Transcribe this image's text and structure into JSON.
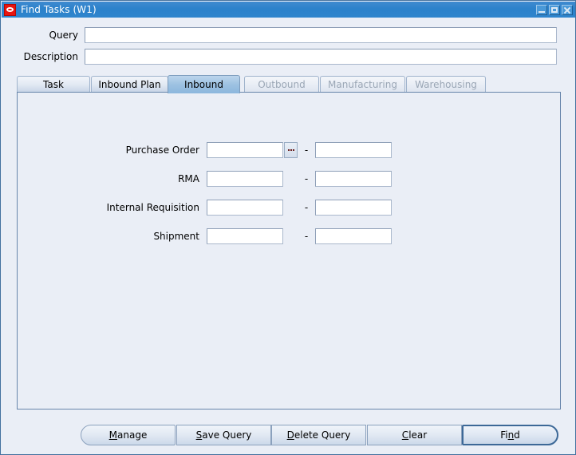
{
  "window": {
    "title": "Find Tasks (W1)",
    "icon": "oracle-logo-icon",
    "controls": {
      "minimize": "minimize-icon",
      "maximize": "maximize-icon",
      "close": "close-icon"
    }
  },
  "header": {
    "query": {
      "label": "Query",
      "value": "",
      "placeholder": ""
    },
    "description": {
      "label": "Description",
      "value": "",
      "placeholder": ""
    }
  },
  "tabs": [
    {
      "label": "Task",
      "state": "enabled",
      "selected": false
    },
    {
      "label": "Inbound Plan",
      "state": "enabled",
      "selected": false
    },
    {
      "label": "Inbound",
      "state": "enabled",
      "selected": true
    },
    {
      "label": "Outbound",
      "state": "disabled",
      "selected": false
    },
    {
      "label": "Manufacturing",
      "state": "disabled",
      "selected": false
    },
    {
      "label": "Warehousing",
      "state": "disabled",
      "selected": false
    }
  ],
  "form": {
    "separator": "-",
    "rows": [
      {
        "label": "Purchase Order",
        "from": "",
        "to": "",
        "lov": true,
        "lov_icon": "ellipsis-lov-icon"
      },
      {
        "label": "RMA",
        "from": "",
        "to": "",
        "lov": false,
        "lov_icon": ""
      },
      {
        "label": "Internal Requisition",
        "from": "",
        "to": "",
        "lov": false,
        "lov_icon": ""
      },
      {
        "label": "Shipment",
        "from": "",
        "to": "",
        "lov": false,
        "lov_icon": ""
      }
    ]
  },
  "buttons": [
    {
      "label": "Manage",
      "mnemonic": "M",
      "default": false
    },
    {
      "label": "Save Query",
      "mnemonic": "S",
      "default": false
    },
    {
      "label": "Delete Query",
      "mnemonic": "D",
      "default": false
    },
    {
      "label": "Clear",
      "mnemonic": "C",
      "default": false
    },
    {
      "label": "Find",
      "mnemonic": "n",
      "default": true
    }
  ],
  "colors": {
    "titlebar": "#2c82cb",
    "window_bg": "#eaeef6",
    "selected_tab": "#9dc2e2",
    "panel_border": "#6785ab",
    "default_button_border": "#3c6897",
    "lov_dots": "#6b2020",
    "app_icon": "#e8140f"
  }
}
